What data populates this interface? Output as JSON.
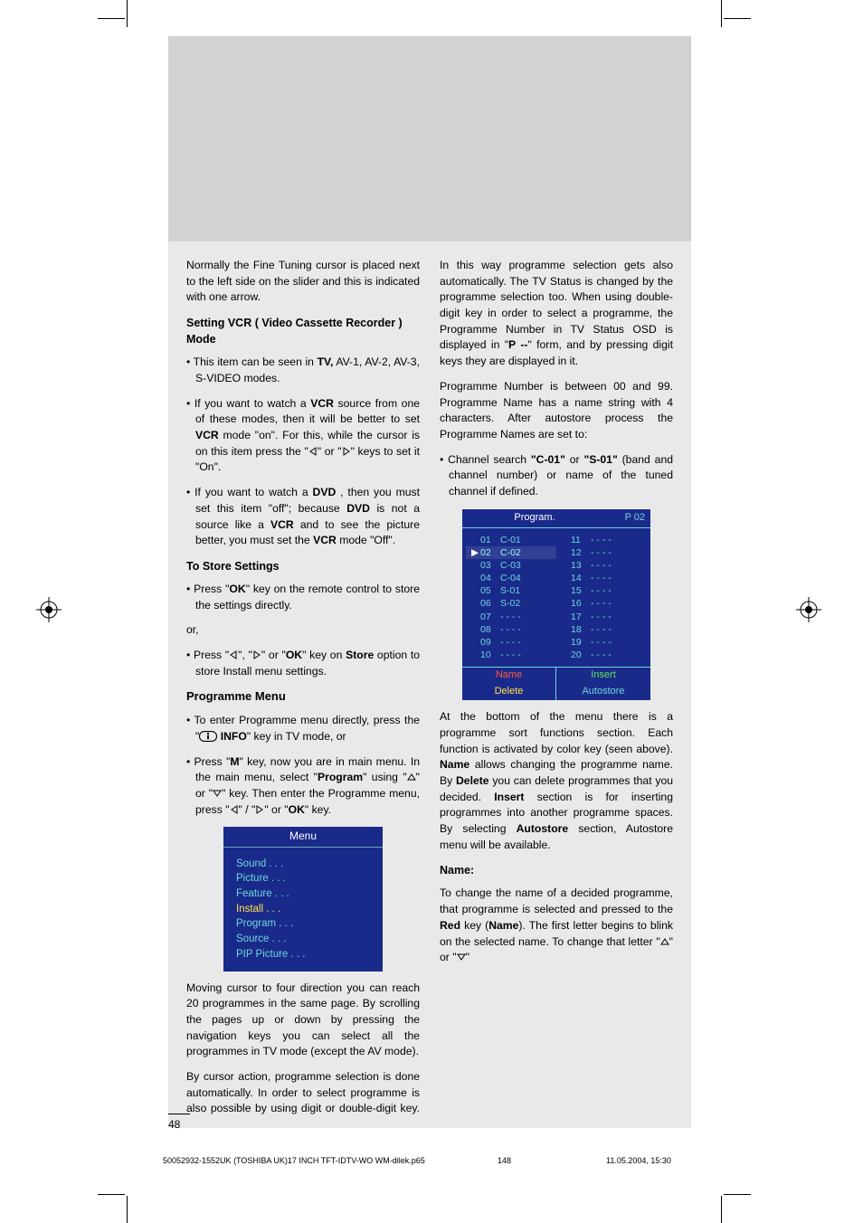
{
  "page_number": "48",
  "intro": "Normally the Fine Tuning cursor is placed next to the left side on the slider and this is indicated with one arrow.",
  "vcr": {
    "heading": "Setting VCR ( Video Cassette Recorder )  Mode",
    "b1_pre": "This item can be seen in ",
    "b1_bold": "TV,",
    "b1_post": " AV-1, AV-2, AV-3, S-VIDEO modes.",
    "b2_pre": "If you want to watch a ",
    "b2_bold1": "VCR",
    "b2_mid1": " source from one of these modes, then  it will be better to set ",
    "b2_bold2": "VCR",
    "b2_mid2": " mode \"on\". For this, while the cursor is on this item press the \"",
    "b2_mid3": "\" or \"",
    "b2_post": "\" keys to set it \"On\".",
    "b3_pre": "If you want to watch a ",
    "b3_bold1": "DVD",
    "b3_mid1": " , then you must set this item \"off\"; because ",
    "b3_bold2": "DVD",
    "b3_mid2": " is not a source like a ",
    "b3_bold3": "VCR",
    "b3_mid3": " and to see the picture better, you must set the ",
    "b3_bold4": "VCR",
    "b3_post": " mode \"Off\"."
  },
  "store": {
    "heading": "To Store Settings",
    "b1_pre": "Press \"",
    "b1_bold": "OK",
    "b1_post": "\" key on the remote control to store the settings directly.",
    "or": "or,",
    "b2_pre": "Press \"",
    "b2_mid1": "\", \"",
    "b2_mid2": "\" or \"",
    "b2_bold1": "OK",
    "b2_mid3": "\" key on ",
    "b2_bold2": "Store",
    "b2_post": " option to store Install menu settings."
  },
  "progmenu": {
    "heading": "Programme Menu",
    "b1_pre": "To enter Programme menu directly, press the \"",
    "b1_bold": " INFO",
    "b1_post": "\" key in TV mode, or",
    "b2_pre": "Press \"",
    "b2_bold1": "M",
    "b2_mid1": "\" key, now you are in main menu. In the main menu, select \"",
    "b2_bold2": "Program",
    "b2_mid2": "\" using \"",
    "b2_mid3": "\" or \"",
    "b2_mid4": "\" key. Then enter the Programme menu, press \"",
    "b2_mid5": "\" / \"",
    "b2_mid6": "\" or \"",
    "b2_bold3": "OK",
    "b2_post": "\" key."
  },
  "menu_box": {
    "title": "Menu",
    "items": [
      "Sound . . .",
      "Picture . . .",
      "Feature . . .",
      "Install . . .",
      "Program . . .",
      "Source . . .",
      "PIP Picture . . ."
    ],
    "highlight_index": 3
  },
  "after_menu": "Moving cursor to four direction you can reach 20 programmes in the same page. By scrolling the pages up or down by pressing the navigation keys you can select all the programmes in TV mode (except the AV mode).",
  "col2": {
    "p1_pre": "By cursor action, programme selection is done automatically. In order to select programme is also possible by using digit or double-digit key. In this way programme selection gets also automatically. The TV Status is changed by the programme selection too. When using double-digit key in order to select a programme, the Programme Number in TV Status OSD is displayed in \"",
    "p1_bold": "P --",
    "p1_post": "\" form, and by pressing digit keys they are displayed in it.",
    "p2": "Programme Number is between 00 and 99. Programme Name has a name string with 4 characters. After autostore process the Programme Names are set to:",
    "b1_pre": "Channel search ",
    "b1_bold1": "\"C-01\"",
    "b1_mid": " or ",
    "b1_bold2": "\"S-01\"",
    "b1_post": " (band and channel number) or name of the tuned channel if defined."
  },
  "program_box": {
    "title": "Program.",
    "pn": "P  02",
    "left": [
      {
        "n": "01",
        "c": "C-01"
      },
      {
        "n": "02",
        "c": "C-02"
      },
      {
        "n": "03",
        "c": "C-03"
      },
      {
        "n": "04",
        "c": "C-04"
      },
      {
        "n": "05",
        "c": "S-01"
      },
      {
        "n": "06",
        "c": "S-02"
      },
      {
        "n": "07",
        "c": "- - - -"
      },
      {
        "n": "08",
        "c": "- - - -"
      },
      {
        "n": "09",
        "c": "- - - -"
      },
      {
        "n": "10",
        "c": "- - - -"
      }
    ],
    "right": [
      {
        "n": "11",
        "c": "- - - -"
      },
      {
        "n": "12",
        "c": "- - - -"
      },
      {
        "n": "13",
        "c": "- - - -"
      },
      {
        "n": "14",
        "c": "- - - -"
      },
      {
        "n": "15",
        "c": "- - - -"
      },
      {
        "n": "16",
        "c": "- - - -"
      },
      {
        "n": "17",
        "c": "- - - -"
      },
      {
        "n": "18",
        "c": "- - - -"
      },
      {
        "n": "19",
        "c": "- - - -"
      },
      {
        "n": "20",
        "c": "- - - -"
      }
    ],
    "selected": 1,
    "footer": {
      "name": "Name",
      "insert": "Insert",
      "delete": "Delete",
      "autostore": "Autostore"
    }
  },
  "after_program": {
    "p_pre": "At the bottom of the menu there is a programme sort functions section. Each function is activated by color key (seen above). ",
    "b1": "Name",
    "m1": " allows changing the programme name. By ",
    "b2": "Delete",
    "m2": " you can delete programmes that you decided. ",
    "b3": "Insert",
    "m3": " section is for inserting programmes into another programme spaces. By selecting ",
    "b4": "Autostore",
    "m4": " section, Autostore menu will be available."
  },
  "name_section": {
    "heading": "Name:",
    "p_pre": "To change the name of a decided programme, that programme is selected and pressed to the ",
    "bold1": "Red",
    "mid1": " key (",
    "bold2": "Name",
    "mid2": "). The first letter begins to blink on the selected name. To change that letter \"",
    "mid3": "\" or \"",
    "post": "\""
  },
  "footer": {
    "file": "50052932-1552UK (TOSHIBA UK)17 INCH TFT-IDTV-WO WM-dilek.p65",
    "page": "148",
    "datetime": "11.05.2004, 15:30"
  }
}
